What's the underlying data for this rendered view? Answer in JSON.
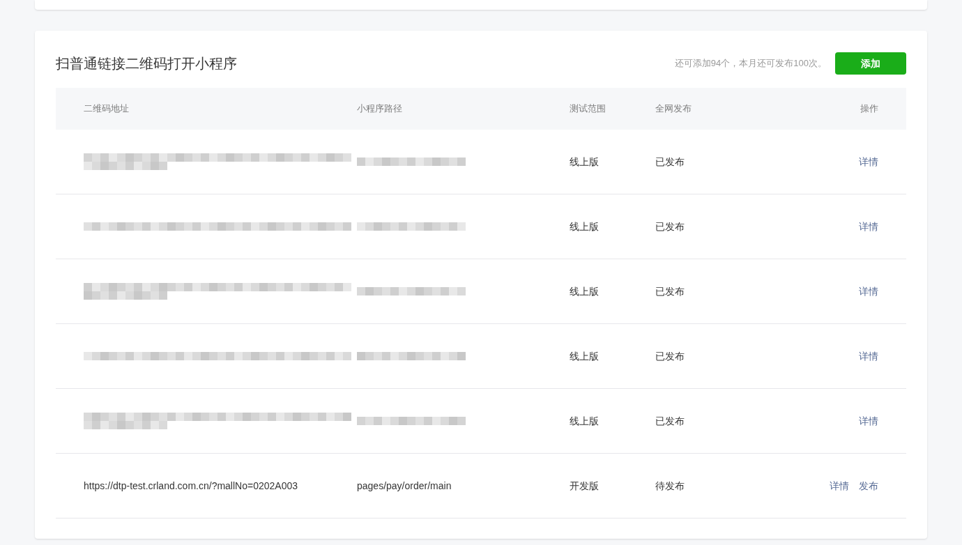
{
  "section": {
    "title": "扫普通链接二维码打开小程序",
    "quota": "还可添加94个，本月还可发布100次。",
    "add_button": "添加"
  },
  "table": {
    "columns": [
      "二维码地址",
      "小程序路径",
      "测试范围",
      "全网发布",
      "操作"
    ],
    "rows": [
      {
        "qr": {
          "redacted": true
        },
        "path": {
          "redacted": true
        },
        "range": "线上版",
        "publish": "已发布",
        "actions": [
          "详情"
        ]
      },
      {
        "qr": {
          "redacted": true
        },
        "path": {
          "redacted": true
        },
        "range": "线上版",
        "publish": "已发布",
        "actions": [
          "详情"
        ]
      },
      {
        "qr": {
          "redacted": true
        },
        "path": {
          "redacted": true
        },
        "range": "线上版",
        "publish": "已发布",
        "actions": [
          "详情"
        ]
      },
      {
        "qr": {
          "redacted": true
        },
        "path": {
          "redacted": true
        },
        "range": "线上版",
        "publish": "已发布",
        "actions": [
          "详情"
        ]
      },
      {
        "qr": {
          "redacted": true
        },
        "path": {
          "redacted": true
        },
        "range": "线上版",
        "publish": "已发布",
        "actions": [
          "详情"
        ]
      },
      {
        "qr": {
          "redacted": false,
          "text": "https://dtp-test.crland.com.cn/?mallNo=0202A003"
        },
        "path": {
          "redacted": false,
          "text": "pages/pay/order/main"
        },
        "range": "开发版",
        "publish": "待发布",
        "actions": [
          "详情",
          "发布"
        ]
      }
    ]
  }
}
